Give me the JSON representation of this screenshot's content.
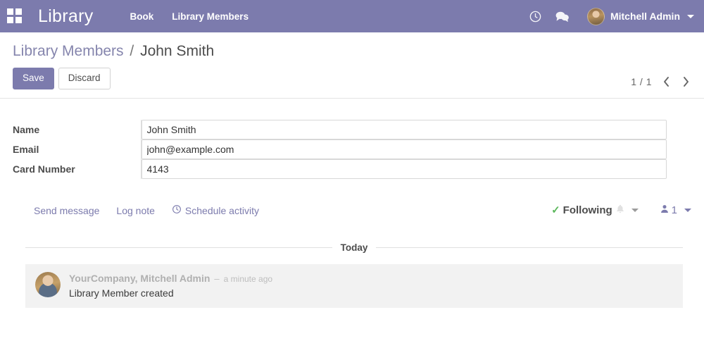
{
  "navbar": {
    "apps_icon": "apps-grid-icon",
    "brand": "Library",
    "menu_items": [
      {
        "label": "Book"
      },
      {
        "label": "Library Members"
      }
    ],
    "activities_icon": "clock-icon",
    "messages_icon": "chat-bubble-icon",
    "user_name": "Mitchell Admin",
    "background_color": "#7c7bad"
  },
  "control_panel": {
    "breadcrumb": {
      "parent": "Library Members",
      "separator": "/",
      "current": "John Smith"
    },
    "save_label": "Save",
    "discard_label": "Discard",
    "pager": {
      "value": "1 / 1",
      "previous_icon": "chevron-left-icon",
      "next_icon": "chevron-right-icon"
    }
  },
  "form": {
    "fields": [
      {
        "label": "Name",
        "value": "John Smith",
        "placeholder": ""
      },
      {
        "label": "Email",
        "value": "john@example.com",
        "placeholder": ""
      },
      {
        "label": "Card Number",
        "value": "4143",
        "placeholder": ""
      }
    ]
  },
  "chatter": {
    "send_message_label": "Send message",
    "log_note_label": "Log note",
    "schedule_activity_label": "Schedule activity",
    "schedule_activity_icon": "clock-icon",
    "following_label": "Following",
    "following_check_icon": "check-icon",
    "bell_icon": "bell-icon",
    "followers_icon": "user-icon",
    "followers_count": "1",
    "date_separator": "Today",
    "messages": [
      {
        "author": "YourCompany, Mitchell Admin",
        "dash": "–",
        "time": "a minute ago",
        "body": "Library Member created"
      }
    ]
  },
  "colors": {
    "accent": "#7c7bad",
    "link": "#8585ad",
    "success": "#5cb85c",
    "message_bg": "#f2f2f2"
  }
}
